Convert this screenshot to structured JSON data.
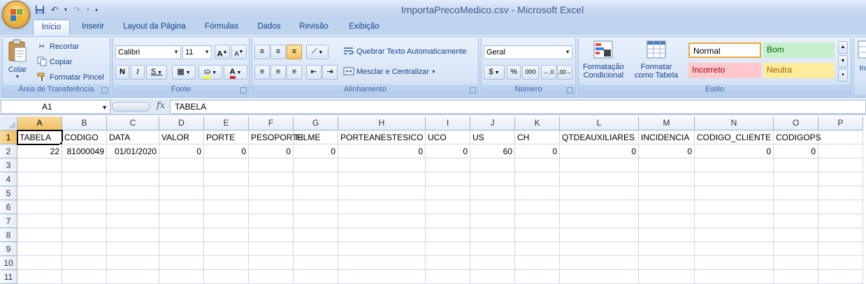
{
  "window": {
    "title": "ImportaPrecoMedico.csv - Microsoft Excel"
  },
  "tabs": [
    "Início",
    "Inserir",
    "Layout da Página",
    "Fórmulas",
    "Dados",
    "Revisão",
    "Exibição"
  ],
  "ribbon": {
    "clipboard": {
      "paste": "Colar",
      "cut": "Recortar",
      "copy": "Copiar",
      "format_painter": "Formatar Pincel",
      "label": "Área de Transferência"
    },
    "font": {
      "name": "Calibri",
      "size": "11",
      "bold": "N",
      "italic": "I",
      "underline": "S",
      "label": "Fonte"
    },
    "alignment": {
      "wrap": "Quebrar Texto Automaticamente",
      "merge": "Mesclar e Centralizar",
      "label": "Alinhamento"
    },
    "number": {
      "format": "Geral",
      "percent": "%",
      "thousands": "000",
      "label": "Número"
    },
    "styles": {
      "conditional_line1": "Formatação",
      "conditional_line2": "Condicional",
      "table_line1": "Formatar",
      "table_line2": "como Tabela",
      "normal": "Normal",
      "good": "Bom",
      "bad": "Incorreto",
      "neutral": "Neutra",
      "label": "Estilo",
      "insert_cut": "In"
    }
  },
  "formula_bar": {
    "name_box": "A1",
    "fx": "fx",
    "value": "TABELA"
  },
  "columns": [
    "A",
    "B",
    "C",
    "D",
    "E",
    "F",
    "G",
    "H",
    "I",
    "J",
    "K",
    "L",
    "M",
    "N",
    "O",
    "P"
  ],
  "rows": [
    "1",
    "2",
    "3",
    "4",
    "5",
    "6",
    "7",
    "8",
    "9",
    "10",
    "11"
  ],
  "sheet": {
    "headers": [
      "TABELA",
      "CODIGO",
      "DATA",
      "VALOR",
      "PORTE",
      "PESOPORTE",
      "FILME",
      "PORTEANESTESICO",
      "UCO",
      "US",
      "CH",
      "QTDEAUXILIARES",
      "INCIDENCIA",
      "CODIGO_CLIENTE",
      "CODIGOPS",
      ""
    ],
    "row2": [
      "22",
      "81000049",
      "01/01/2020",
      "0",
      "0",
      "0",
      "0",
      "0",
      "0",
      "60",
      "0",
      "0",
      "0",
      "0",
      "0",
      ""
    ]
  },
  "colors": {
    "select_header": "#f1c15f",
    "normal_style_border": "#e5a93c",
    "good_bg": "#c6efce",
    "good_text": "#006100",
    "bad_bg": "#ffc7ce",
    "bad_text": "#9c0006",
    "neutral_bg": "#ffeb9c",
    "neutral_text": "#9c6500"
  }
}
